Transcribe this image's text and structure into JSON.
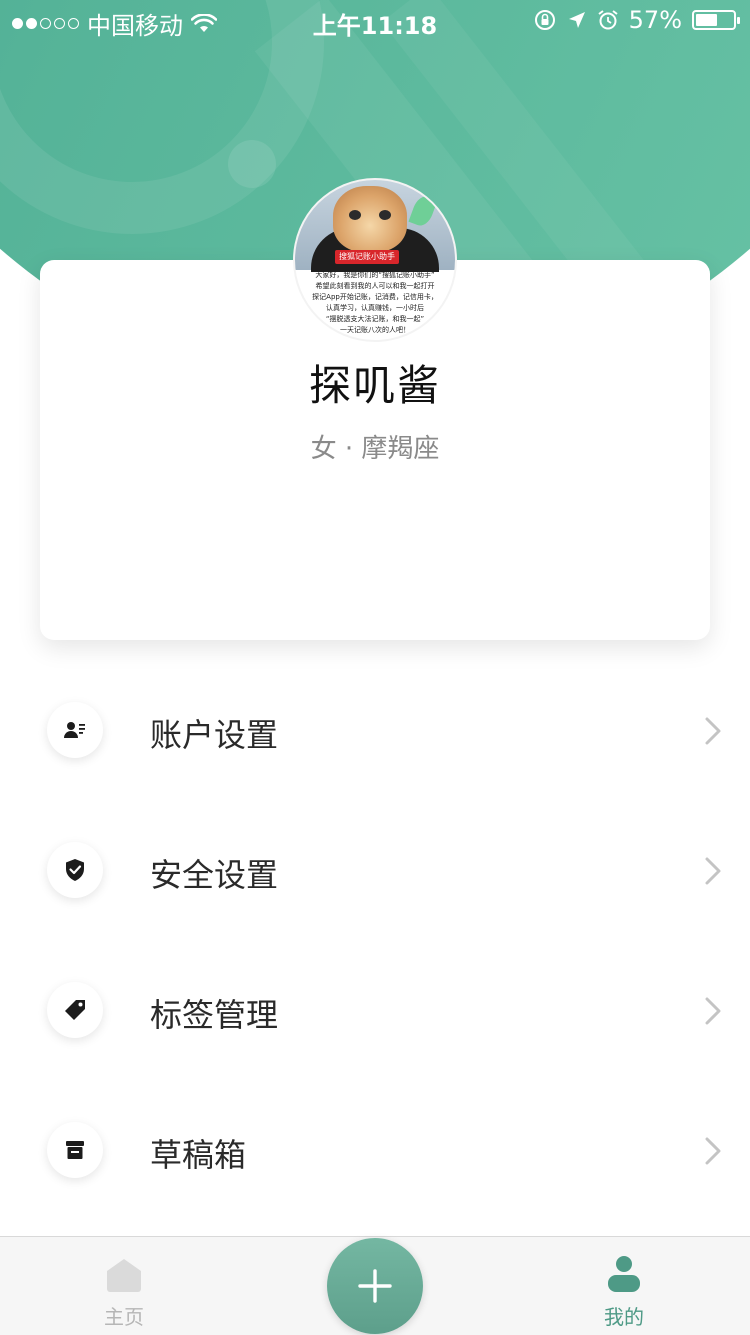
{
  "status_bar": {
    "carrier": "中国移动",
    "time": "上午11:18",
    "battery": "57%",
    "battery_level": 0.57,
    "signal_bars": 2,
    "signal_total": 5
  },
  "profile": {
    "avatar_tag": "搜狐记账小助手",
    "avatar_caption": [
      "大家好，我是你们的“搜狐记账小助手”",
      "希望此刻看到我的人可以和我一起打开",
      "探记App开始记账，记消费，记信用卡，",
      "认真学习，认真赚钱，一小时后",
      "“摆脱透支大法记账，和我一起”",
      "一天记账八次的人吧！"
    ],
    "name": "探叽酱",
    "info": "女 · 摩羯座"
  },
  "menu": {
    "items": [
      {
        "label": "账户设置",
        "icon": "account-card-icon"
      },
      {
        "label": "安全设置",
        "icon": "shield-check-icon"
      },
      {
        "label": "标签管理",
        "icon": "tag-icon"
      },
      {
        "label": "草稿箱",
        "icon": "draft-box-icon"
      }
    ]
  },
  "tabbar": {
    "home_label": "主页",
    "add_icon": "plus-icon",
    "mine_label": "我的",
    "active_color": "#4e9a86",
    "inactive_color": "#b6b6b6"
  },
  "theme": {
    "accent": "#55b398"
  }
}
